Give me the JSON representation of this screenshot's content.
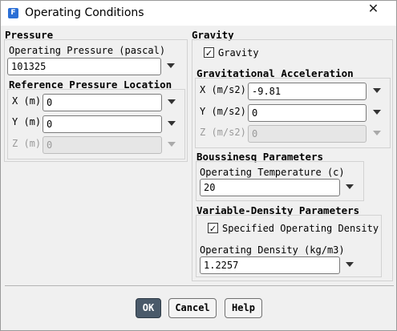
{
  "window": {
    "title": "Operating Conditions",
    "app_icon_letter": "F"
  },
  "pressure": {
    "title": "Pressure",
    "operating_pressure_label": "Operating Pressure (pascal)",
    "operating_pressure_value": "101325",
    "reference_location_title": "Reference Pressure Location",
    "x_label": "X (m)",
    "x_value": "0",
    "y_label": "Y (m)",
    "y_value": "0",
    "z_label": "Z (m)",
    "z_value": "0"
  },
  "gravity": {
    "title": "Gravity",
    "checkbox_label": "Gravity",
    "checked": true,
    "accel_title": "Gravitational Acceleration",
    "x_label": "X (m/s2)",
    "x_value": "-9.81",
    "y_label": "Y (m/s2)",
    "y_value": "0",
    "z_label": "Z (m/s2)",
    "z_value": "0"
  },
  "boussinesq": {
    "title": "Boussinesq Parameters",
    "temp_label": "Operating Temperature (c)",
    "temp_value": "20"
  },
  "variable_density": {
    "title": "Variable-Density Parameters",
    "checkbox_label": "Specified Operating Density",
    "checked": true,
    "density_label": "Operating Density (kg/m3)",
    "density_value": "1.2257"
  },
  "buttons": {
    "ok": "OK",
    "cancel": "Cancel",
    "help": "Help"
  },
  "icons": {
    "check": "✓",
    "close": "✕"
  }
}
